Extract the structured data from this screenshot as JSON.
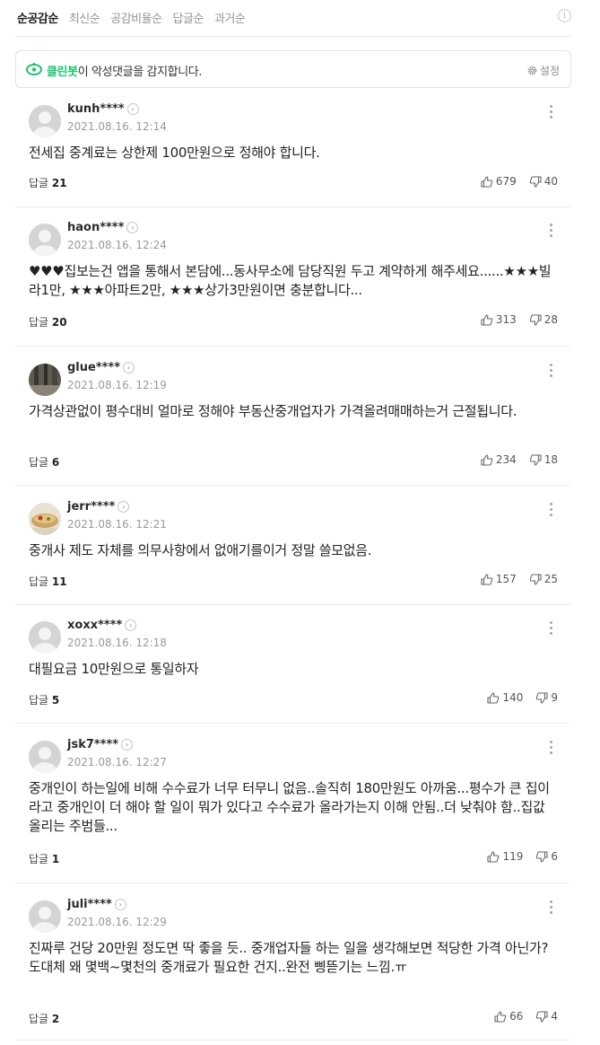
{
  "tabs": [
    {
      "label": "순공감순",
      "active": true
    },
    {
      "label": "최신순",
      "active": false
    },
    {
      "label": "공감비율순",
      "active": false
    },
    {
      "label": "답글순",
      "active": false
    },
    {
      "label": "과거순",
      "active": false
    }
  ],
  "info_icon_glyph": "i",
  "cleanbot": {
    "name": "클린봇",
    "message": "이 악성댓글을 감지합니다.",
    "settings_label": "설정",
    "accent_color": "#1cc46c"
  },
  "reply_label": "답글",
  "comments": [
    {
      "nick": "kunh****",
      "date": "2021.08.16. 12:14",
      "text": "전세집 중계료는 상한제 100만원으로 정해야 합니다.",
      "replies": "21",
      "likes": "679",
      "dislikes": "40",
      "avatar": "default"
    },
    {
      "nick": "haon****",
      "date": "2021.08.16. 12:24",
      "text": "♥♥♥집보는건 앱을 통해서 본담에...동사무소에 담당직원 두고 계약하게 해주세요......★★★빌라1만, ★★★아파트2만, ★★★상가3만원이면 충분합니다...",
      "replies": "20",
      "likes": "313",
      "dislikes": "28",
      "avatar": "default"
    },
    {
      "nick": "glue****",
      "date": "2021.08.16. 12:19",
      "text": "가격상관없이 평수대비 얼마로 정해야 부동산중개업자가 가격올려매매하는거 근절됩니다.",
      "replies": "6",
      "likes": "234",
      "dislikes": "18",
      "avatar": "photo-dark"
    },
    {
      "nick": "jerr****",
      "date": "2021.08.16. 12:21",
      "text": "중개사 제도 자체를 의무사항에서 없애기를이거 정말 쓸모없음.",
      "replies": "11",
      "likes": "157",
      "dislikes": "25",
      "avatar": "photo-food"
    },
    {
      "nick": "xoxx****",
      "date": "2021.08.16. 12:18",
      "text": "대필요금 10만원으로 통일하자",
      "replies": "5",
      "likes": "140",
      "dislikes": "9",
      "avatar": "default"
    },
    {
      "nick": "jsk7****",
      "date": "2021.08.16. 12:27",
      "text": "중개인이 하는일에 비해 수수료가 너무 터무니 없음..솔직히 180만원도 아까움...평수가 큰 집이라고 중개인이 더 해야 할 일이 뭐가 있다고 수수료가 올라가는지 이해 안됨..더 낮춰야 함..집값 올리는 주범들...",
      "replies": "1",
      "likes": "119",
      "dislikes": "6",
      "avatar": "default"
    },
    {
      "nick": "juli****",
      "date": "2021.08.16. 12:29",
      "text": "진짜루 건당 20만원 정도면 딱 좋을 듯.. 중개업자들 하는 일을 생각해보면 적당한 가격 아닌가? 도대체 왜 몇백~몇천의 중개료가 필요한 건지..완전 삥뜯기는 느낌.ㅠ",
      "replies": "2",
      "likes": "66",
      "dislikes": "4",
      "avatar": "default"
    }
  ]
}
